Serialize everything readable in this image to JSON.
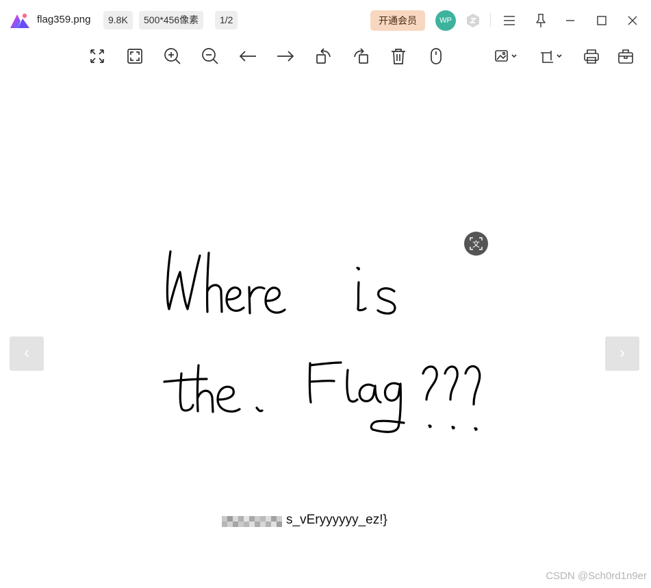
{
  "titlebar": {
    "file_name": "flag359.png",
    "file_size": "9.8K",
    "dimensions": "500*456像素",
    "page_indicator": "1/2",
    "vip_label": "开通会员",
    "avatar_initials": "WP"
  },
  "toolbar": {
    "icons": [
      "fit-screen-icon",
      "fullscreen-icon",
      "zoom-in-icon",
      "zoom-out-icon",
      "previous-arrow-icon",
      "next-arrow-icon",
      "rotate-left-icon",
      "rotate-right-icon",
      "delete-icon",
      "mouse-icon",
      "edit-image-icon",
      "crop-icon",
      "print-icon",
      "toolbox-icon"
    ]
  },
  "viewer": {
    "nav_prev": "‹",
    "nav_next": "›",
    "ocr_label": "文",
    "handwriting": [
      "Where is",
      "the Flag???"
    ],
    "flag_visible_text": "s_vEryyyyyy_ez!}"
  },
  "watermark": "CSDN @Sch0rd1n9er",
  "colors": {
    "vip_bg": "#f8d7c0",
    "avatar_bg": "#3db39e",
    "nav_bg": "#e3e3e3",
    "ink": "#000000"
  }
}
